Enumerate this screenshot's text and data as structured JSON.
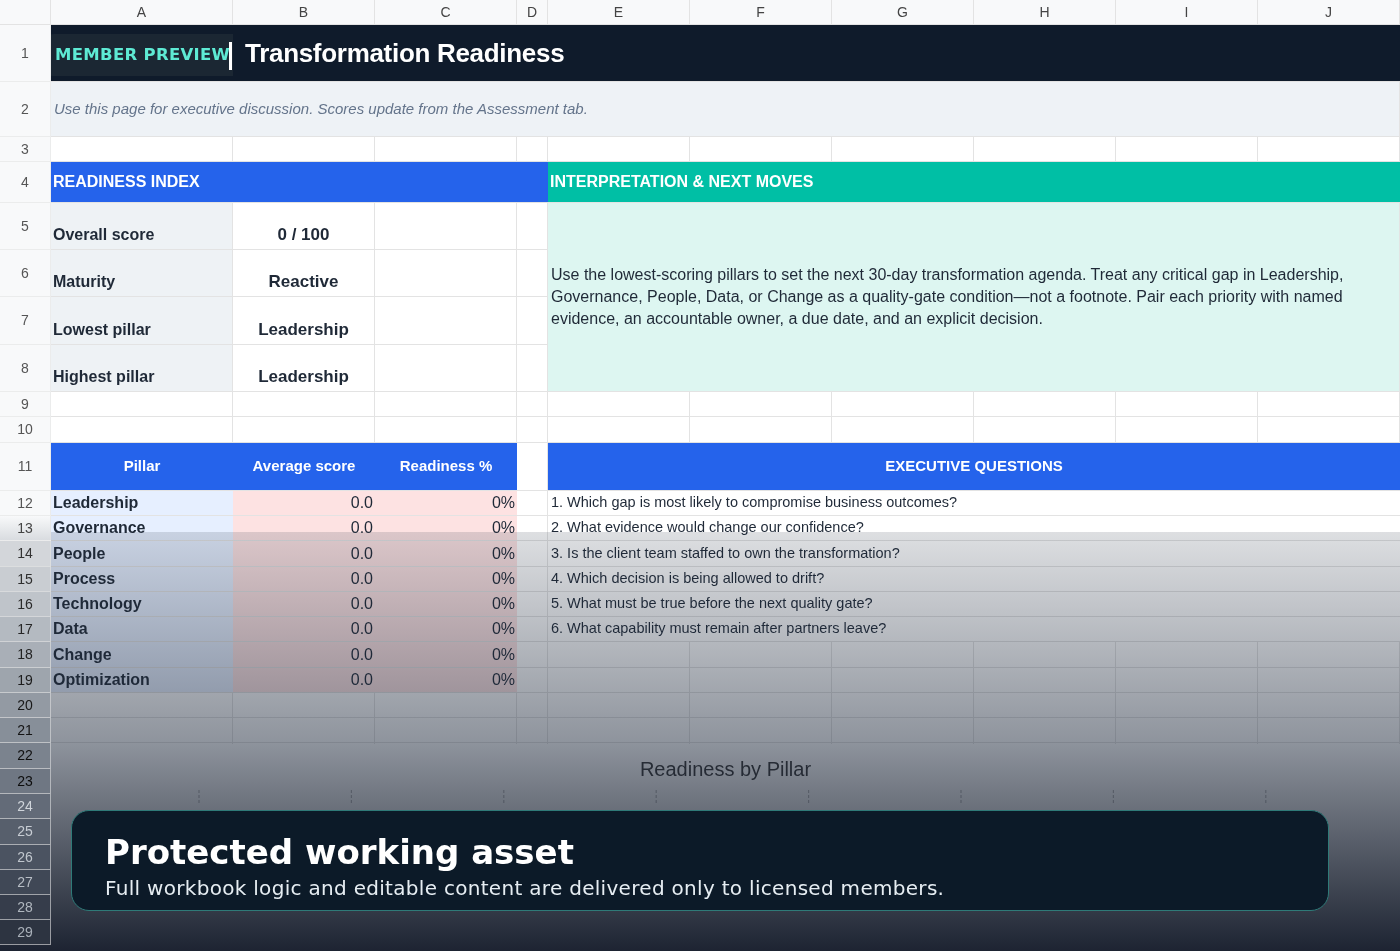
{
  "column_headers": [
    "A",
    "B",
    "C",
    "D",
    "E",
    "F",
    "G",
    "H",
    "I",
    "J"
  ],
  "row_numbers": [
    "1",
    "2",
    "3",
    "4",
    "5",
    "6",
    "7",
    "8",
    "9",
    "10",
    "11",
    "12",
    "13",
    "14",
    "15",
    "16",
    "17",
    "18",
    "19",
    "20",
    "21",
    "22",
    "23",
    "24",
    "25",
    "26",
    "27",
    "28",
    "29"
  ],
  "badge": {
    "label": "MEMBER PREVIEW"
  },
  "title": "Transformation Readiness",
  "subtitle": "Use this page for executive discussion. Scores update from the Assessment tab.",
  "readiness_index": {
    "heading": "READINESS INDEX",
    "rows": [
      {
        "label": "Overall score",
        "value": "0 / 100"
      },
      {
        "label": "Maturity",
        "value": "Reactive"
      },
      {
        "label": "Lowest pillar",
        "value": "Leadership"
      },
      {
        "label": "Highest pillar",
        "value": "Leadership"
      }
    ]
  },
  "interpretation": {
    "heading": "INTERPRETATION & NEXT MOVES",
    "text": "Use the lowest-scoring pillars to set the next 30-day transformation agenda. Treat any critical gap in Leadership, Governance, People, Data, or Change as a quality-gate condition—not a footnote. Pair each priority with named evidence, an accountable owner, a due date, and an explicit decision."
  },
  "pillar_table": {
    "columns": [
      "Pillar",
      "Average score",
      "Readiness %"
    ],
    "rows": [
      {
        "pillar": "Leadership",
        "average_score": "0.0",
        "readiness": "0%"
      },
      {
        "pillar": "Governance",
        "average_score": "0.0",
        "readiness": "0%"
      },
      {
        "pillar": "People",
        "average_score": "0.0",
        "readiness": "0%"
      },
      {
        "pillar": "Process",
        "average_score": "0.0",
        "readiness": "0%"
      },
      {
        "pillar": "Technology",
        "average_score": "0.0",
        "readiness": "0%"
      },
      {
        "pillar": "Data",
        "average_score": "0.0",
        "readiness": "0%"
      },
      {
        "pillar": "Change",
        "average_score": "0.0",
        "readiness": "0%"
      },
      {
        "pillar": "Optimization",
        "average_score": "0.0",
        "readiness": "0%"
      }
    ]
  },
  "executive_questions": {
    "heading": "EXECUTIVE QUESTIONS",
    "items": [
      "1. Which gap is most likely to compromise business outcomes?",
      "2. What evidence would change our confidence?",
      "3. Is the client team staffed to own the transformation?",
      "4. Which decision is being allowed to drift?",
      "5. What must be true before the next quality gate?",
      "6. What capability must remain after partners leave?"
    ]
  },
  "chart": {
    "title": "Readiness by Pillar"
  },
  "notice": {
    "title": "Protected working asset",
    "text": "Full workbook logic and editable content are delivered only to licensed members."
  }
}
